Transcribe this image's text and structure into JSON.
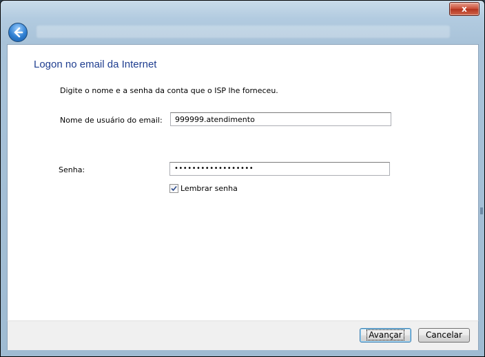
{
  "dialog": {
    "heading": "Logon no email da Internet",
    "description": "Digite o nome e a senha da conta que o ISP lhe forneceu."
  },
  "form": {
    "username_label": "Nome de usuário do email:",
    "username_value": "999999.atendimento",
    "password_label": "Senha:",
    "password_value": "••••••••••••••••••",
    "remember_label": "Lembrar senha",
    "remember_checked": true
  },
  "buttons": {
    "next": "Avançar",
    "cancel": "Cancelar",
    "close": "x"
  },
  "colors": {
    "heading": "#1e3d8f",
    "frame": "#a9c3d9",
    "close": "#c84a33"
  },
  "icons": {
    "back": "back-arrow-icon",
    "close": "close-icon",
    "check": "checkmark-icon"
  }
}
